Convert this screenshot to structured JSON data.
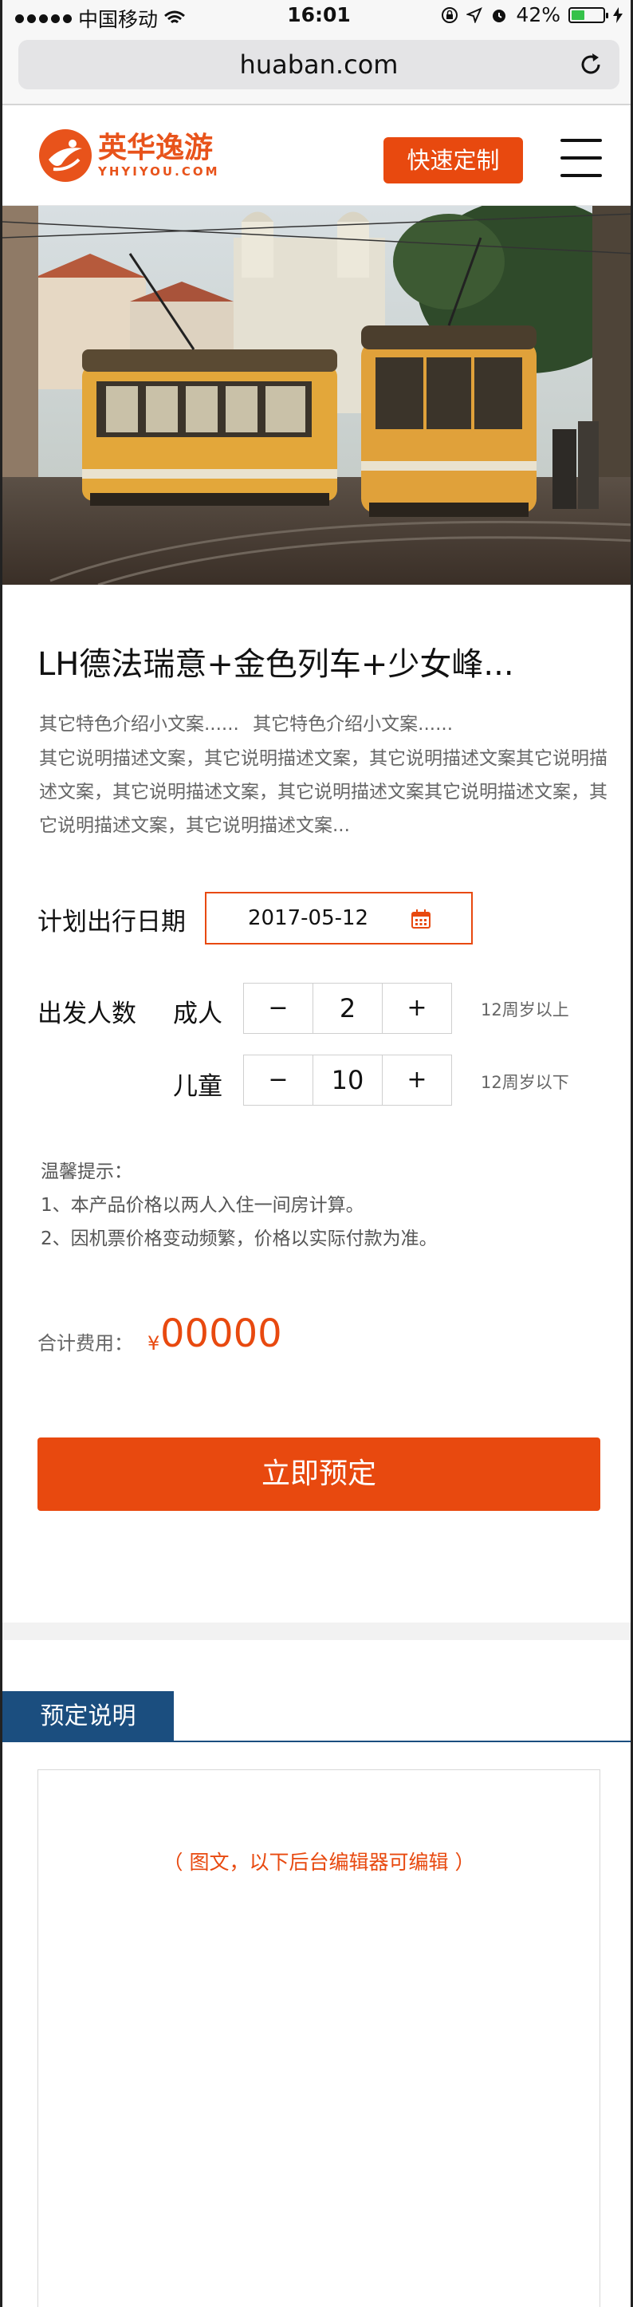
{
  "status_bar": {
    "carrier": "中国移动",
    "time": "16:01",
    "battery": "42%",
    "battery_level": 0.42
  },
  "browser": {
    "url": "huaban.com"
  },
  "header": {
    "logo_cn": "英华逸游",
    "logo_en": "YHYIYOU.COM",
    "quick_button": "快速定制"
  },
  "product": {
    "title": "LH德法瑞意+金色列车+少女峰...",
    "features": "其它特色介绍小文案......  其它特色介绍小文案......",
    "description": "其它说明描述文案，其它说明描述文案，其它说明描述文案其它说明描述文案，其它说明描述文案，其它说明描述文案其它说明描述文案，其它说明描述文案，其它说明描述文案..."
  },
  "form": {
    "date_label": "计划出行日期",
    "date_value": "2017-05-12",
    "people_label": "出发人数",
    "adult_label": "成人",
    "adult_count": "2",
    "adult_note": "12周岁以上",
    "child_label": "儿童",
    "child_count": "10",
    "child_note": "12周岁以下",
    "minus": "−",
    "plus": "+"
  },
  "tips": {
    "title": "温馨提示：",
    "line1": "1、本产品价格以两人入住一间房计算。",
    "line2": "2、因机票价格变动频繁，价格以实际付款为准。"
  },
  "total": {
    "label": "合计费用：",
    "currency": "¥",
    "value": "00000"
  },
  "book_button": "立即预定",
  "section": {
    "tab": "预定说明",
    "editor_hint": "（ 图文，以下后台编辑器可编辑 ）"
  },
  "colors": {
    "accent": "#e8490f",
    "tab_blue": "#1b4e7f"
  }
}
